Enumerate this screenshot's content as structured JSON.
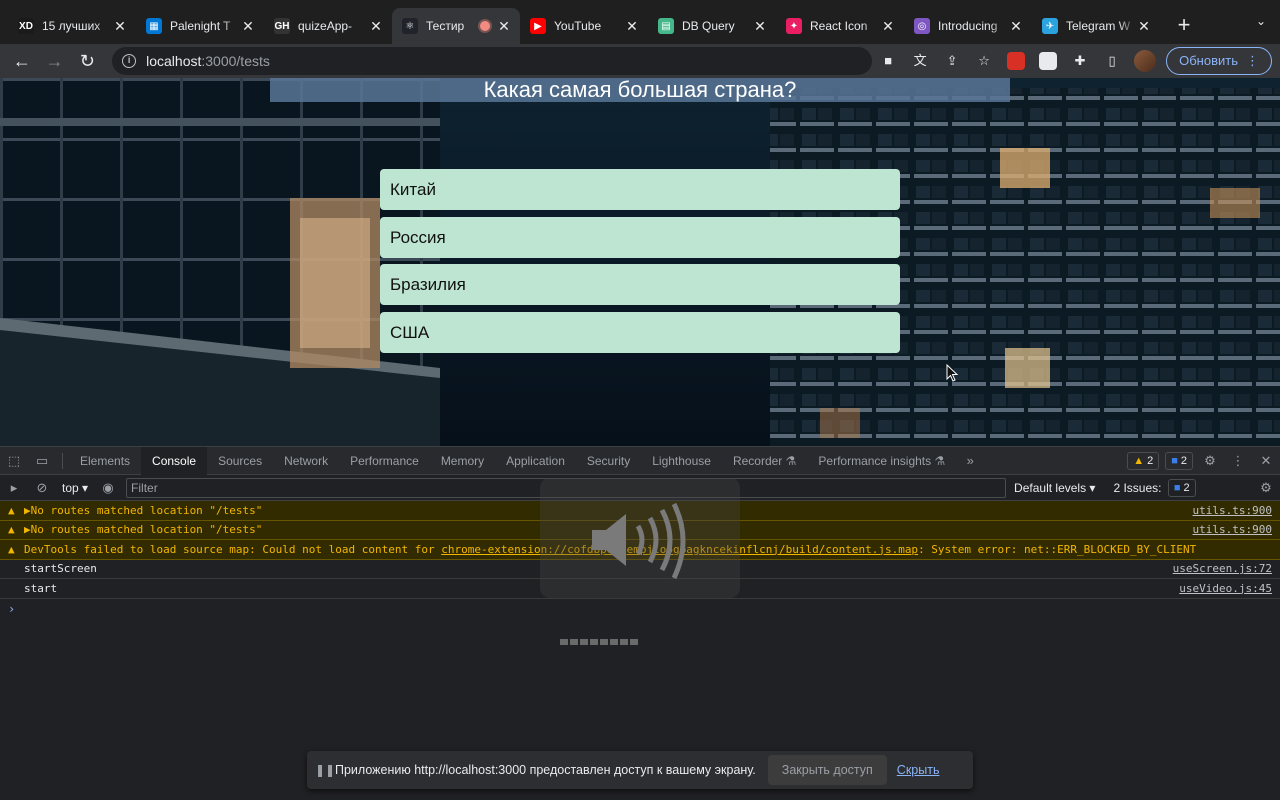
{
  "browser": {
    "tabs": [
      {
        "label": "15 лучших",
        "favicon_color": "#1a1a1a",
        "favicon_glyph": "XD",
        "active": false
      },
      {
        "label": "Palenight T",
        "favicon_color": "#0078d4",
        "favicon_glyph": "▦",
        "active": false
      },
      {
        "label": "quizeApp-",
        "favicon_color": "#333333",
        "favicon_glyph": "GH",
        "active": false
      },
      {
        "label": "Тестир",
        "favicon_color": "#20232a",
        "favicon_glyph": "⚛",
        "active": true,
        "recording": true
      },
      {
        "label": "YouTube",
        "favicon_color": "#ff0000",
        "favicon_glyph": "▶",
        "active": false
      },
      {
        "label": "DB Query",
        "favicon_color": "#44b78b",
        "favicon_glyph": "▤",
        "active": false
      },
      {
        "label": "React Icon",
        "favicon_color": "#e91e63",
        "favicon_glyph": "✦",
        "active": false
      },
      {
        "label": "Introducing",
        "favicon_color": "#7e57c2",
        "favicon_glyph": "◎",
        "active": false
      },
      {
        "label": "Telegram W",
        "favicon_color": "#2aa3df",
        "favicon_glyph": "✈",
        "active": false
      }
    ],
    "new_tab_glyph": "+",
    "url_host": "localhost",
    "url_path": ":3000/tests",
    "update_button": "Обновить"
  },
  "page": {
    "question": "Какая самая большая страна?",
    "answers": [
      "Китай",
      "Россия",
      "Бразилия",
      "США"
    ]
  },
  "devtools": {
    "tabs": [
      "Elements",
      "Console",
      "Sources",
      "Network",
      "Performance",
      "Memory",
      "Application",
      "Security",
      "Lighthouse",
      "Recorder ⚗",
      "Performance insights ⚗"
    ],
    "active_tab": "Console",
    "warnings_count": "2",
    "messages_count": "2",
    "context": "top",
    "filter_placeholder": "Filter",
    "levels": "Default levels",
    "issues": "2 Issues:",
    "issues_count": "2",
    "console_rows": [
      {
        "type": "warn",
        "text": "▶No routes matched location \"/tests\"",
        "source": "utils.ts:900"
      },
      {
        "type": "warn",
        "text": "▶No routes matched location \"/tests\"",
        "source": "utils.ts:900"
      },
      {
        "type": "warn",
        "text_before": "DevTools failed to load source map: Could not load content for ",
        "link": "chrome-extension://cofdbpoegempjloogbagkncekinflcnj/build/content.js.map",
        "text_after": ": System error: net::ERR_BLOCKED_BY_CLIENT",
        "source": ""
      },
      {
        "type": "log",
        "text": "startScreen",
        "source": "useScreen.js:72"
      },
      {
        "type": "log",
        "text": "start",
        "source": "useVideo.js:45"
      }
    ]
  },
  "share_banner": {
    "text": "Приложению http://localhost:3000 предоставлен доступ к вашему экрану.",
    "stop_button": "Закрыть доступ",
    "hide_link": "Скрыть"
  }
}
